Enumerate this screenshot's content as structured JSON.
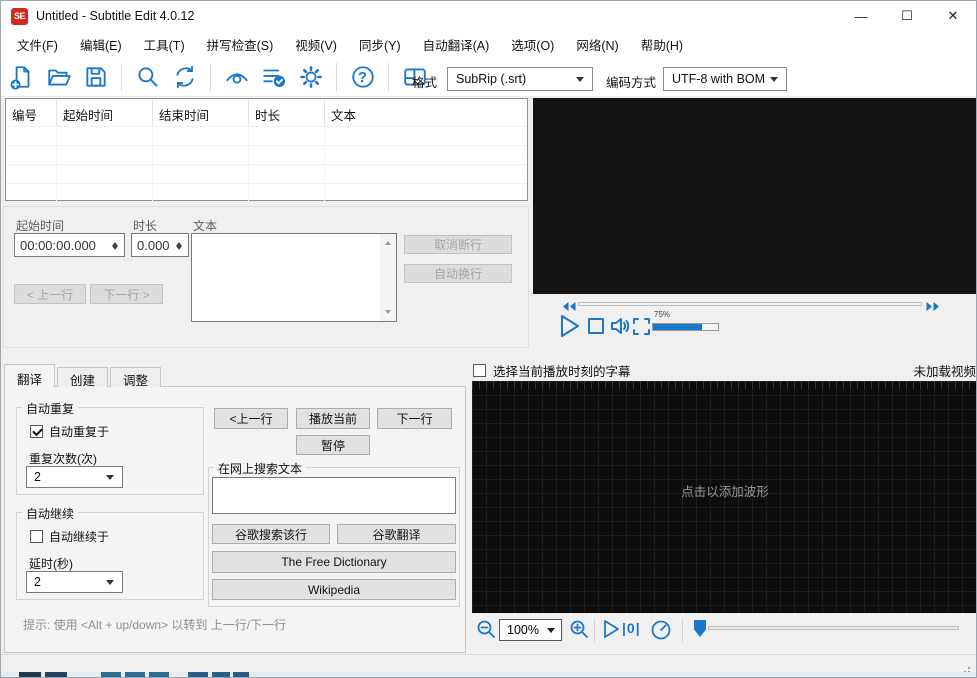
{
  "window": {
    "logo": "SE",
    "title": "Untitled - Subtitle Edit 4.0.12",
    "controls": {
      "minimize": "—",
      "maximize": "☐",
      "close": "✕"
    },
    "accent_color": "#1b78c9"
  },
  "menu": {
    "items": [
      {
        "label": "文件(F)"
      },
      {
        "label": "编辑(E)"
      },
      {
        "label": "工具(T)"
      },
      {
        "label": "拼写检查(S)"
      },
      {
        "label": "视频(V)"
      },
      {
        "label": "同步(Y)"
      },
      {
        "label": "自动翻译(A)"
      },
      {
        "label": "选项(O)"
      },
      {
        "label": "网络(N)"
      },
      {
        "label": "帮助(H)"
      }
    ]
  },
  "toolbar": {
    "icons": [
      "new-file",
      "open-file",
      "save",
      "find",
      "replace",
      "visual-sync",
      "spell-check",
      "settings",
      "help",
      "layout"
    ],
    "help_glyph": "?",
    "format_label": "格式",
    "format_value": "SubRip (.srt)",
    "encoding_label": "编码方式",
    "encoding_value": "UTF-8 with BOM"
  },
  "subtitle_list": {
    "columns": [
      {
        "label": "编号"
      },
      {
        "label": "起始时间"
      },
      {
        "label": "结束时间"
      },
      {
        "label": "时长"
      },
      {
        "label": "文本"
      }
    ],
    "rows": []
  },
  "edit_panel": {
    "start_time_label": "起始时间",
    "start_time_value": "00:00:00.000",
    "duration_label": "时长",
    "duration_value": "0.000",
    "text_label": "文本",
    "unbreak_button": "取消断行",
    "autobreak_button": "自动换行",
    "prev_button": "< 上一行",
    "next_button": "下一行 >"
  },
  "video_player": {
    "icons": [
      "rewind",
      "fast-forward",
      "play",
      "stop",
      "volume",
      "fullscreen"
    ],
    "volume_label": "75%"
  },
  "tabs": {
    "items": [
      {
        "label": "翻译"
      },
      {
        "label": "创建"
      },
      {
        "label": "调整"
      }
    ]
  },
  "translate": {
    "auto_repeat_group": "自动重复",
    "auto_repeat_check": "自动重复于",
    "auto_repeat_checked": true,
    "repeat_count_label": "重复次数(次)",
    "repeat_count_value": "2",
    "auto_continue_group": "自动继续",
    "auto_continue_check": "自动继续于",
    "auto_continue_checked": false,
    "delay_label": "延时(秒)",
    "delay_value": "2",
    "prev_line_button": "<上一行",
    "play_current_button": "播放当前",
    "next_line_button": "下一行",
    "pause_button": "暂停",
    "web_search_group": "在网上搜索文本",
    "search_input_value": "",
    "google_search_button": "谷歌搜索该行",
    "google_translate_button": "谷歌翻译",
    "free_dictionary_button": "The Free Dictionary",
    "wikipedia_button": "Wikipedia",
    "hint": "提示: 使用 <Alt + up/down> 以转到 上一行/下一行"
  },
  "waveform": {
    "select_current_label": "选择当前播放时刻的字幕",
    "select_current_checked": false,
    "no_video_label": "未加载视频",
    "placeholder": "点击以添加波形",
    "zoom_value": "100%",
    "play_from_start_glyph": "|0|",
    "icons": [
      "zoom-out",
      "zoom-in",
      "play",
      "play-from-start",
      "playback-speed"
    ]
  }
}
